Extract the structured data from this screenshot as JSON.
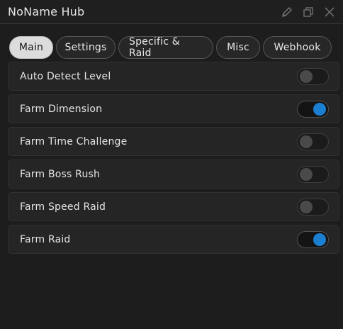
{
  "window": {
    "title": "NoName Hub",
    "icons": [
      "pencil-icon",
      "restore-icon",
      "close-icon"
    ]
  },
  "tabs": [
    {
      "label": "Main",
      "active": true
    },
    {
      "label": "Settings",
      "active": false
    },
    {
      "label": "Specific & Raid",
      "active": false
    },
    {
      "label": "Misc",
      "active": false
    },
    {
      "label": "Webhook",
      "active": false
    }
  ],
  "toggles": [
    {
      "label": "Auto Detect Level",
      "on": false
    },
    {
      "label": "Farm Dimension",
      "on": true
    },
    {
      "label": "Farm Time Challenge",
      "on": false
    },
    {
      "label": "Farm Boss Rush",
      "on": false
    },
    {
      "label": "Farm Speed Raid",
      "on": false
    },
    {
      "label": "Farm Raid",
      "on": true
    }
  ],
  "colors": {
    "background": "#1d1d1d",
    "row": "#252525",
    "accent": "#1b7fd1",
    "active_tab": "#dcdcdc"
  }
}
